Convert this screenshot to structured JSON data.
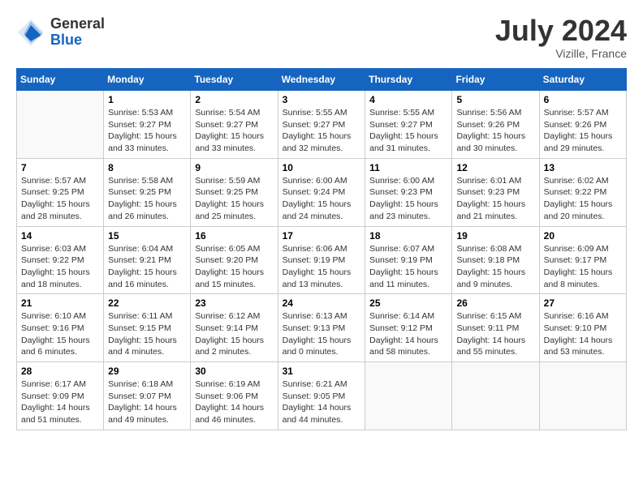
{
  "header": {
    "logo_general": "General",
    "logo_blue": "Blue",
    "month_year": "July 2024",
    "location": "Vizille, France"
  },
  "days_of_week": [
    "Sunday",
    "Monday",
    "Tuesday",
    "Wednesday",
    "Thursday",
    "Friday",
    "Saturday"
  ],
  "weeks": [
    [
      {
        "day": "",
        "info": ""
      },
      {
        "day": "1",
        "info": "Sunrise: 5:53 AM\nSunset: 9:27 PM\nDaylight: 15 hours\nand 33 minutes."
      },
      {
        "day": "2",
        "info": "Sunrise: 5:54 AM\nSunset: 9:27 PM\nDaylight: 15 hours\nand 33 minutes."
      },
      {
        "day": "3",
        "info": "Sunrise: 5:55 AM\nSunset: 9:27 PM\nDaylight: 15 hours\nand 32 minutes."
      },
      {
        "day": "4",
        "info": "Sunrise: 5:55 AM\nSunset: 9:27 PM\nDaylight: 15 hours\nand 31 minutes."
      },
      {
        "day": "5",
        "info": "Sunrise: 5:56 AM\nSunset: 9:26 PM\nDaylight: 15 hours\nand 30 minutes."
      },
      {
        "day": "6",
        "info": "Sunrise: 5:57 AM\nSunset: 9:26 PM\nDaylight: 15 hours\nand 29 minutes."
      }
    ],
    [
      {
        "day": "7",
        "info": "Sunrise: 5:57 AM\nSunset: 9:25 PM\nDaylight: 15 hours\nand 28 minutes."
      },
      {
        "day": "8",
        "info": "Sunrise: 5:58 AM\nSunset: 9:25 PM\nDaylight: 15 hours\nand 26 minutes."
      },
      {
        "day": "9",
        "info": "Sunrise: 5:59 AM\nSunset: 9:25 PM\nDaylight: 15 hours\nand 25 minutes."
      },
      {
        "day": "10",
        "info": "Sunrise: 6:00 AM\nSunset: 9:24 PM\nDaylight: 15 hours\nand 24 minutes."
      },
      {
        "day": "11",
        "info": "Sunrise: 6:00 AM\nSunset: 9:23 PM\nDaylight: 15 hours\nand 23 minutes."
      },
      {
        "day": "12",
        "info": "Sunrise: 6:01 AM\nSunset: 9:23 PM\nDaylight: 15 hours\nand 21 minutes."
      },
      {
        "day": "13",
        "info": "Sunrise: 6:02 AM\nSunset: 9:22 PM\nDaylight: 15 hours\nand 20 minutes."
      }
    ],
    [
      {
        "day": "14",
        "info": "Sunrise: 6:03 AM\nSunset: 9:22 PM\nDaylight: 15 hours\nand 18 minutes."
      },
      {
        "day": "15",
        "info": "Sunrise: 6:04 AM\nSunset: 9:21 PM\nDaylight: 15 hours\nand 16 minutes."
      },
      {
        "day": "16",
        "info": "Sunrise: 6:05 AM\nSunset: 9:20 PM\nDaylight: 15 hours\nand 15 minutes."
      },
      {
        "day": "17",
        "info": "Sunrise: 6:06 AM\nSunset: 9:19 PM\nDaylight: 15 hours\nand 13 minutes."
      },
      {
        "day": "18",
        "info": "Sunrise: 6:07 AM\nSunset: 9:19 PM\nDaylight: 15 hours\nand 11 minutes."
      },
      {
        "day": "19",
        "info": "Sunrise: 6:08 AM\nSunset: 9:18 PM\nDaylight: 15 hours\nand 9 minutes."
      },
      {
        "day": "20",
        "info": "Sunrise: 6:09 AM\nSunset: 9:17 PM\nDaylight: 15 hours\nand 8 minutes."
      }
    ],
    [
      {
        "day": "21",
        "info": "Sunrise: 6:10 AM\nSunset: 9:16 PM\nDaylight: 15 hours\nand 6 minutes."
      },
      {
        "day": "22",
        "info": "Sunrise: 6:11 AM\nSunset: 9:15 PM\nDaylight: 15 hours\nand 4 minutes."
      },
      {
        "day": "23",
        "info": "Sunrise: 6:12 AM\nSunset: 9:14 PM\nDaylight: 15 hours\nand 2 minutes."
      },
      {
        "day": "24",
        "info": "Sunrise: 6:13 AM\nSunset: 9:13 PM\nDaylight: 15 hours\nand 0 minutes."
      },
      {
        "day": "25",
        "info": "Sunrise: 6:14 AM\nSunset: 9:12 PM\nDaylight: 14 hours\nand 58 minutes."
      },
      {
        "day": "26",
        "info": "Sunrise: 6:15 AM\nSunset: 9:11 PM\nDaylight: 14 hours\nand 55 minutes."
      },
      {
        "day": "27",
        "info": "Sunrise: 6:16 AM\nSunset: 9:10 PM\nDaylight: 14 hours\nand 53 minutes."
      }
    ],
    [
      {
        "day": "28",
        "info": "Sunrise: 6:17 AM\nSunset: 9:09 PM\nDaylight: 14 hours\nand 51 minutes."
      },
      {
        "day": "29",
        "info": "Sunrise: 6:18 AM\nSunset: 9:07 PM\nDaylight: 14 hours\nand 49 minutes."
      },
      {
        "day": "30",
        "info": "Sunrise: 6:19 AM\nSunset: 9:06 PM\nDaylight: 14 hours\nand 46 minutes."
      },
      {
        "day": "31",
        "info": "Sunrise: 6:21 AM\nSunset: 9:05 PM\nDaylight: 14 hours\nand 44 minutes."
      },
      {
        "day": "",
        "info": ""
      },
      {
        "day": "",
        "info": ""
      },
      {
        "day": "",
        "info": ""
      }
    ]
  ]
}
